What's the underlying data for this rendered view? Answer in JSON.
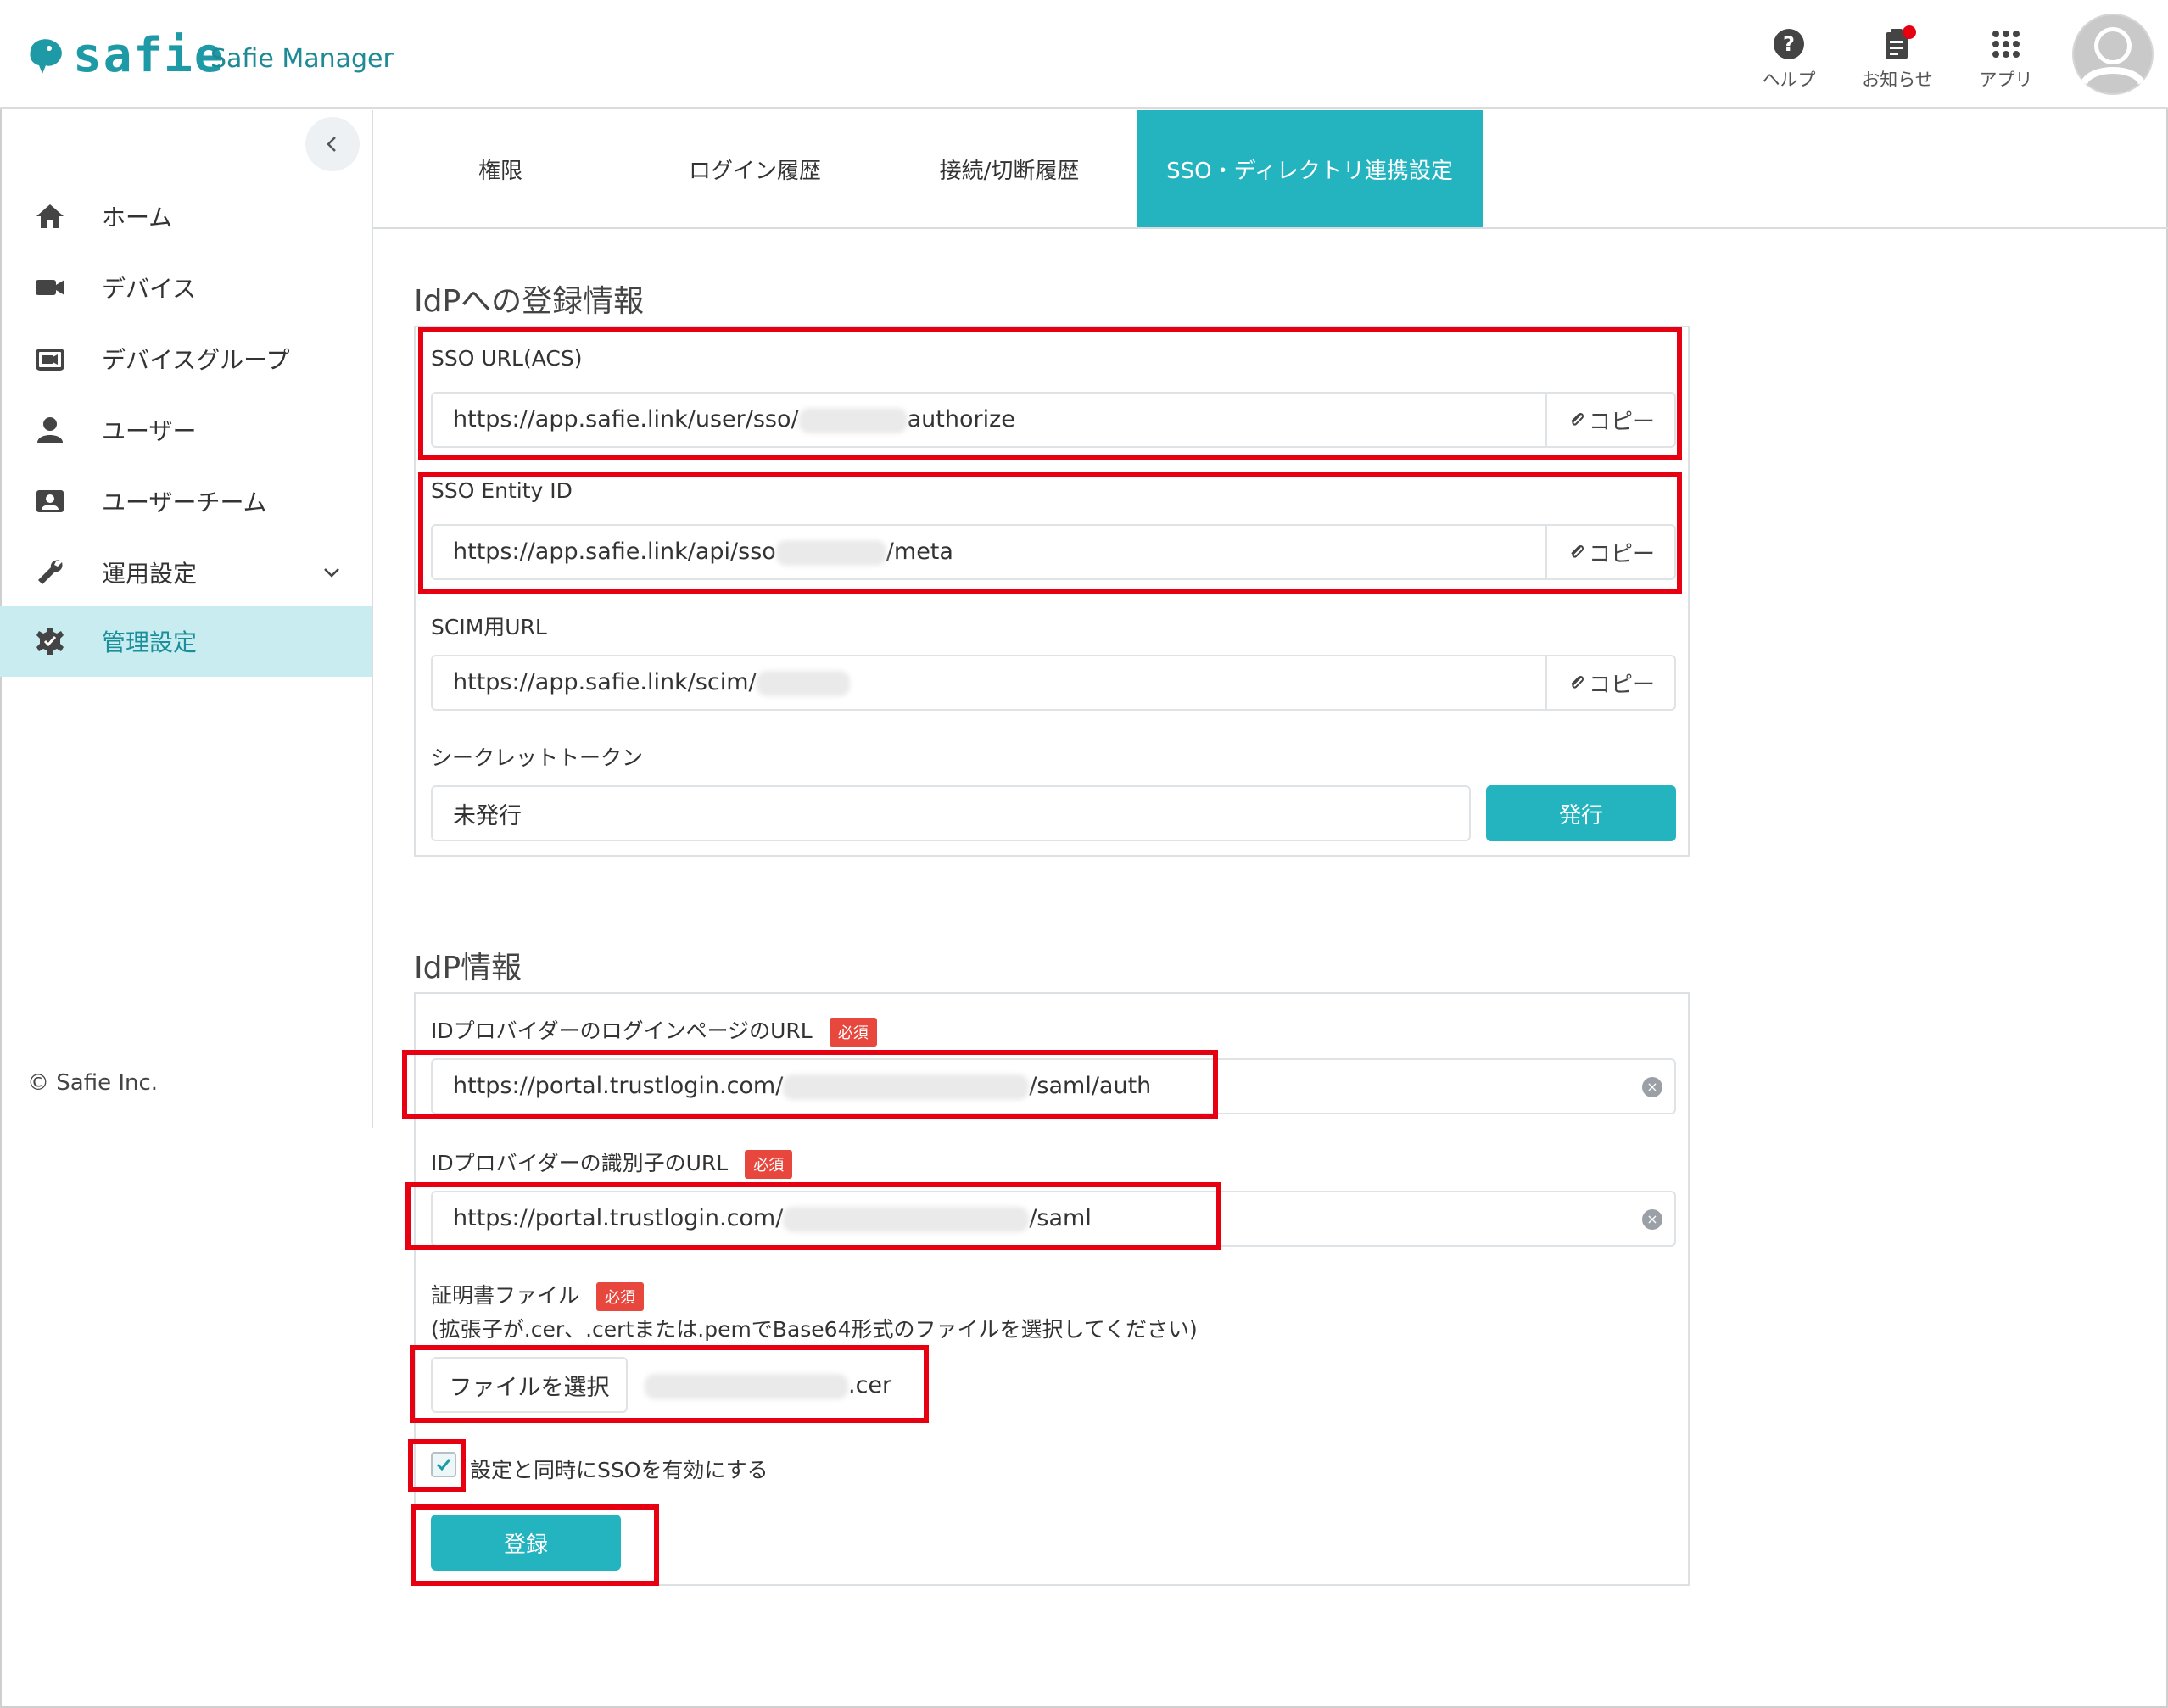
{
  "header": {
    "logo_text": "safie",
    "app_name": "Safie Manager",
    "help_label": "ヘルプ",
    "notifications_label": "お知らせ",
    "apps_label": "アプリ"
  },
  "sidebar": {
    "items": [
      {
        "label": "ホーム",
        "icon": "home-icon"
      },
      {
        "label": "デバイス",
        "icon": "video-camera-icon"
      },
      {
        "label": "デバイスグループ",
        "icon": "device-group-icon"
      },
      {
        "label": "ユーザー",
        "icon": "user-icon"
      },
      {
        "label": "ユーザーチーム",
        "icon": "user-team-icon"
      },
      {
        "label": "運用設定",
        "icon": "wrench-icon"
      },
      {
        "label": "管理設定",
        "icon": "gear-icon",
        "active": true
      }
    ],
    "copyright": "© Safie Inc."
  },
  "tabs": [
    {
      "label": "権限"
    },
    {
      "label": "ログイン履歴"
    },
    {
      "label": "接続/切断履歴"
    },
    {
      "label": "SSO・ディレクトリ連携設定",
      "active": true
    }
  ],
  "idp_registration": {
    "title": "IdPへの登録情報",
    "sso_url": {
      "label": "SSO URL(ACS)",
      "value_prefix": "https://app.safie.link/user/sso/",
      "value_suffix": "authorize",
      "copy_label": "コピー"
    },
    "entity_id": {
      "label": "SSO Entity ID",
      "value_prefix": "https://app.safie.link/api/sso",
      "value_suffix": "/meta",
      "copy_label": "コピー"
    },
    "scim_url": {
      "label": "SCIM用URL",
      "value_prefix": "https://app.safie.link/scim/",
      "value_suffix": "",
      "copy_label": "コピー"
    },
    "secret_token": {
      "label": "シークレットトークン",
      "value": "未発行",
      "issue_label": "発行"
    }
  },
  "idp_info": {
    "title": "IdP情報",
    "required_badge": "必須",
    "login_url": {
      "label": "IDプロバイダーのログインページのURL",
      "value_prefix": "https://portal.trustlogin.com/",
      "value_suffix": "/saml/auth"
    },
    "identifier_url": {
      "label": "IDプロバイダーの識別子のURL",
      "value_prefix": "https://portal.trustlogin.com/",
      "value_suffix": "/saml"
    },
    "certificate": {
      "label": "証明書ファイル",
      "hint": "(拡張子が.cer、.certまたは.pemでBase64形式のファイルを選択してください)",
      "choose_label": "ファイルを選択",
      "file_suffix": ".cer"
    },
    "enable_sso_label": "設定と同時にSSOを有効にする",
    "enable_sso_checked": true,
    "register_label": "登録"
  },
  "colors": {
    "accent": "#23b4bf",
    "brand": "#1d9aa6",
    "highlight": "#e60012",
    "required": "#e8473e"
  }
}
